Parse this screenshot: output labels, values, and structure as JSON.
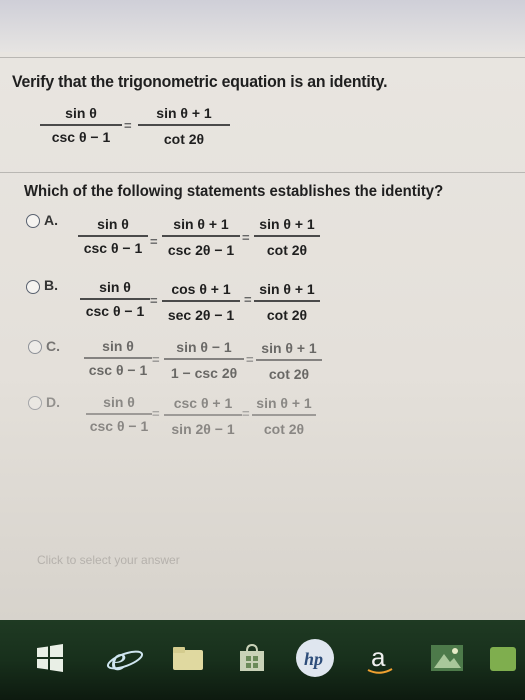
{
  "question": "Verify that the trigonometric equation is an identity.",
  "equation": {
    "left_num": "sin θ",
    "left_den": "csc θ − 1",
    "right_num": "sin θ + 1",
    "right_den": "cot 2θ"
  },
  "prompt": "Which of the following statements establishes the identity?",
  "options": [
    {
      "letter": "A.",
      "f1_num": "sin θ",
      "f1_den": "csc θ − 1",
      "f2_num": "sin θ + 1",
      "f2_den": "csc 2θ − 1",
      "f3_num": "sin θ + 1",
      "f3_den": "cot 2θ"
    },
    {
      "letter": "B.",
      "f1_num": "sin θ",
      "f1_den": "csc θ − 1",
      "f2_num": "cos θ + 1",
      "f2_den": "sec 2θ − 1",
      "f3_num": "sin θ + 1",
      "f3_den": "cot 2θ"
    },
    {
      "letter": "C.",
      "f1_num": "sin θ",
      "f1_den": "csc θ − 1",
      "f2_num": "sin θ − 1",
      "f2_den": "1 − csc 2θ",
      "f3_num": "sin θ + 1",
      "f3_den": "cot 2θ"
    },
    {
      "letter": "D.",
      "f1_num": "sin θ",
      "f1_den": "csc θ − 1",
      "f2_num": "csc θ + 1",
      "f2_den": "sin 2θ − 1",
      "f3_num": "sin θ + 1",
      "f3_den": "cot 2θ"
    }
  ],
  "equals": "=",
  "hint": "Click to select your answer",
  "taskbar": {
    "apps": [
      "windows-start-icon",
      "internet-explorer-icon",
      "file-explorer-icon",
      "store-icon",
      "hp-icon",
      "amazon-icon",
      "photos-icon"
    ],
    "amazon_label": "a",
    "hp_label": "hp"
  },
  "colors": {
    "accent": "#3f6fb0",
    "taskbar": "#1c3320"
  }
}
